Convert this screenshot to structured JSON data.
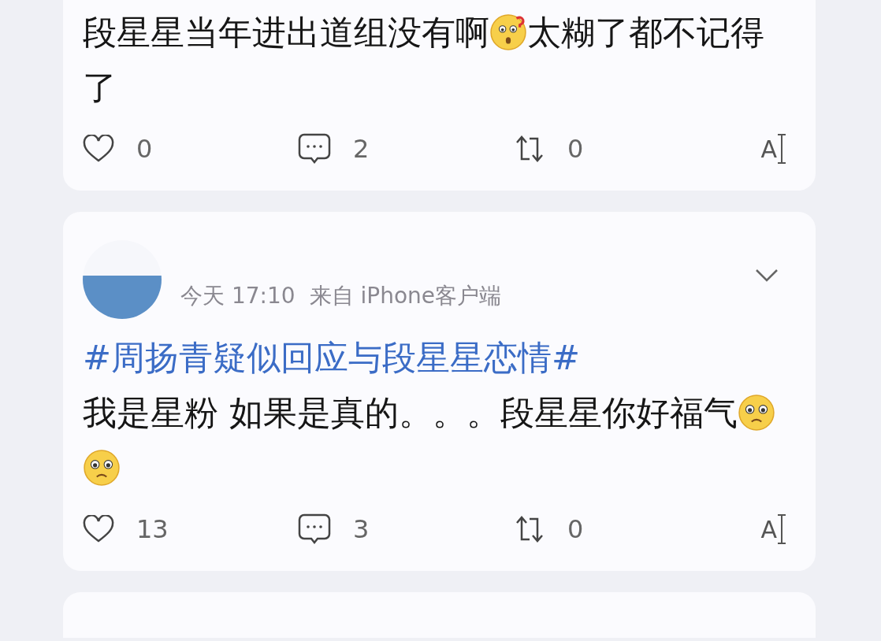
{
  "posts": [
    {
      "content": [
        {
          "kind": "text",
          "text": "段星星当年进出道组没有啊"
        },
        {
          "kind": "thinking"
        },
        {
          "kind": "text",
          "text": "太糊了都不记得"
        },
        {
          "kind": "text",
          "text": "了"
        }
      ],
      "actions": {
        "likes": "0",
        "comments": "2",
        "reposts": "0",
        "tool_glyph": "A"
      }
    },
    {
      "meta": {
        "time": "今天 17:10",
        "source": "来自 iPhone客户端"
      },
      "hashtag": "#周扬青疑似回应与段星星恋情#",
      "content": [
        {
          "kind": "text",
          "text": "我是星粉 如果是真的。。。段星星你好福气"
        },
        {
          "kind": "pleading"
        },
        {
          "kind": "pleading"
        }
      ],
      "actions": {
        "likes": "13",
        "comments": "3",
        "reposts": "0",
        "tool_glyph": "A"
      }
    }
  ]
}
